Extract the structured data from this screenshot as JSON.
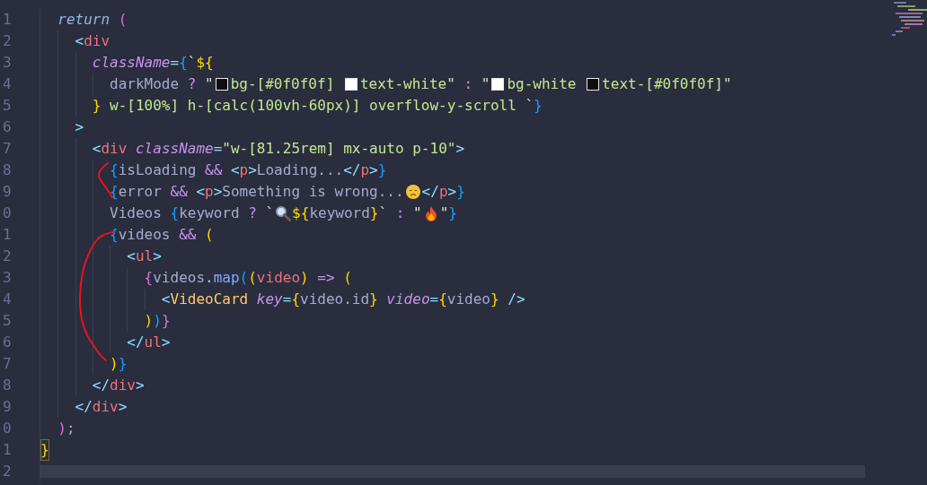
{
  "editor": {
    "lines": [
      {
        "number": "1",
        "tokens": [
          {
            "text": "  return ",
            "kind": "keyword"
          },
          {
            "text": "(",
            "kind": "b2"
          }
        ]
      },
      {
        "number": "2",
        "tokens": [
          {
            "text": "    <",
            "kind": "punct"
          },
          {
            "text": "div",
            "kind": "tag"
          }
        ]
      },
      {
        "number": "3",
        "tokens": [
          {
            "text": "      className",
            "kind": "attr"
          },
          {
            "text": "=",
            "kind": "punct"
          },
          {
            "text": "{",
            "kind": "b3"
          },
          {
            "text": "`",
            "kind": "quote"
          },
          {
            "text": "${",
            "kind": "b1"
          }
        ]
      },
      {
        "number": "4",
        "tokens": [
          {
            "text": "        darkMode ",
            "kind": "plain"
          },
          {
            "text": "?",
            "kind": "op"
          },
          {
            "text": " \"",
            "kind": "quote"
          },
          {
            "kind": "swatch",
            "color": "#0f0f0f"
          },
          {
            "text": "bg-[#0f0f0f] ",
            "kind": "string"
          },
          {
            "kind": "swatch",
            "color": "#ffffff"
          },
          {
            "text": "text-white",
            "kind": "string"
          },
          {
            "text": "\" ",
            "kind": "quote"
          },
          {
            "text": ":",
            "kind": "op"
          },
          {
            "text": " \"",
            "kind": "quote"
          },
          {
            "kind": "swatch",
            "color": "#ffffff"
          },
          {
            "text": "bg-white ",
            "kind": "string"
          },
          {
            "kind": "swatch",
            "color": "#0f0f0f"
          },
          {
            "text": "text-[#0f0f0f]",
            "kind": "string"
          },
          {
            "text": "\"",
            "kind": "quote"
          }
        ]
      },
      {
        "number": "5",
        "tokens": [
          {
            "text": "      }",
            "kind": "b1"
          },
          {
            "text": " w-[100%] h-[calc(100vh-60px)] overflow-y-scroll ",
            "kind": "string"
          },
          {
            "text": "`",
            "kind": "quote"
          },
          {
            "text": "}",
            "kind": "b3"
          }
        ]
      },
      {
        "number": "6",
        "tokens": [
          {
            "text": "    >",
            "kind": "punct"
          }
        ]
      },
      {
        "number": "7",
        "tokens": [
          {
            "text": "      <",
            "kind": "punct"
          },
          {
            "text": "div",
            "kind": "tag"
          },
          {
            "text": " className",
            "kind": "attr"
          },
          {
            "text": "=",
            "kind": "punct"
          },
          {
            "text": "\"w-[81.25rem] mx-auto p-10\"",
            "kind": "string"
          },
          {
            "text": ">",
            "kind": "punct"
          }
        ]
      },
      {
        "number": "8",
        "tokens": [
          {
            "text": "        {",
            "kind": "b3"
          },
          {
            "text": "isLoading ",
            "kind": "plain"
          },
          {
            "text": "&&",
            "kind": "op"
          },
          {
            "text": " <",
            "kind": "punct"
          },
          {
            "text": "p",
            "kind": "tag"
          },
          {
            "text": ">",
            "kind": "punct"
          },
          {
            "text": "Loading...",
            "kind": "plain"
          },
          {
            "text": "</",
            "kind": "punct"
          },
          {
            "text": "p",
            "kind": "tag"
          },
          {
            "text": ">",
            "kind": "punct"
          },
          {
            "text": "}",
            "kind": "b3"
          }
        ]
      },
      {
        "number": "9",
        "tokens": [
          {
            "text": "        {",
            "kind": "b3"
          },
          {
            "text": "error ",
            "kind": "plain"
          },
          {
            "text": "&&",
            "kind": "op"
          },
          {
            "text": " <",
            "kind": "punct"
          },
          {
            "text": "p",
            "kind": "tag"
          },
          {
            "text": ">",
            "kind": "punct"
          },
          {
            "text": "Something is wrong...",
            "kind": "plain"
          },
          {
            "kind": "sad-emoji"
          },
          {
            "text": "</",
            "kind": "punct"
          },
          {
            "text": "p",
            "kind": "tag"
          },
          {
            "text": ">",
            "kind": "punct"
          },
          {
            "text": "}",
            "kind": "b3"
          }
        ]
      },
      {
        "number": "0",
        "tokens": [
          {
            "text": "        Videos ",
            "kind": "plain"
          },
          {
            "text": "{",
            "kind": "b3"
          },
          {
            "text": "keyword ",
            "kind": "plain"
          },
          {
            "text": "?",
            "kind": "op"
          },
          {
            "text": " `",
            "kind": "quote"
          },
          {
            "kind": "search-emoji"
          },
          {
            "text": "${",
            "kind": "b1"
          },
          {
            "text": "keyword",
            "kind": "plain"
          },
          {
            "text": "}",
            "kind": "b1"
          },
          {
            "text": "` ",
            "kind": "quote"
          },
          {
            "text": ":",
            "kind": "op"
          },
          {
            "text": " \"",
            "kind": "quote"
          },
          {
            "kind": "fire-emoji"
          },
          {
            "text": "\"",
            "kind": "quote"
          },
          {
            "text": "}",
            "kind": "b3"
          }
        ]
      },
      {
        "number": "1",
        "tokens": [
          {
            "text": "        {",
            "kind": "b3"
          },
          {
            "text": "videos ",
            "kind": "plain"
          },
          {
            "text": "&&",
            "kind": "op"
          },
          {
            "text": " (",
            "kind": "b1"
          }
        ]
      },
      {
        "number": "2",
        "tokens": [
          {
            "text": "          <",
            "kind": "punct"
          },
          {
            "text": "ul",
            "kind": "tag"
          },
          {
            "text": ">",
            "kind": "punct"
          }
        ]
      },
      {
        "number": "3",
        "tokens": [
          {
            "text": "            {",
            "kind": "b2"
          },
          {
            "text": "videos",
            "kind": "plain"
          },
          {
            "text": ".",
            "kind": "punct"
          },
          {
            "text": "map",
            "kind": "func"
          },
          {
            "text": "(",
            "kind": "b3"
          },
          {
            "text": "(",
            "kind": "b1"
          },
          {
            "text": "video",
            "kind": "param"
          },
          {
            "text": ")",
            "kind": "b1"
          },
          {
            "text": " =>",
            "kind": "op"
          },
          {
            "text": " (",
            "kind": "b1"
          }
        ]
      },
      {
        "number": "4",
        "tokens": [
          {
            "text": "              <",
            "kind": "punct"
          },
          {
            "text": "VideoCard",
            "kind": "component"
          },
          {
            "text": " key",
            "kind": "attr"
          },
          {
            "text": "=",
            "kind": "punct"
          },
          {
            "text": "{",
            "kind": "b1"
          },
          {
            "text": "video.id",
            "kind": "plain"
          },
          {
            "text": "}",
            "kind": "b1"
          },
          {
            "text": " video",
            "kind": "attr"
          },
          {
            "text": "=",
            "kind": "punct"
          },
          {
            "text": "{",
            "kind": "b1"
          },
          {
            "text": "video",
            "kind": "plain"
          },
          {
            "text": "}",
            "kind": "b1"
          },
          {
            "text": " />",
            "kind": "punct"
          }
        ]
      },
      {
        "number": "5",
        "tokens": [
          {
            "text": "            )",
            "kind": "b1"
          },
          {
            "text": ")",
            "kind": "b3"
          },
          {
            "text": "}",
            "kind": "b2"
          }
        ]
      },
      {
        "number": "6",
        "tokens": [
          {
            "text": "          </",
            "kind": "punct"
          },
          {
            "text": "ul",
            "kind": "tag"
          },
          {
            "text": ">",
            "kind": "punct"
          }
        ]
      },
      {
        "number": "7",
        "tokens": [
          {
            "text": "        )",
            "kind": "b1"
          },
          {
            "text": "}",
            "kind": "b3"
          }
        ]
      },
      {
        "number": "8",
        "tokens": [
          {
            "text": "      </",
            "kind": "punct"
          },
          {
            "text": "div",
            "kind": "tag"
          },
          {
            "text": ">",
            "kind": "punct"
          }
        ]
      },
      {
        "number": "9",
        "tokens": [
          {
            "text": "    </",
            "kind": "punct"
          },
          {
            "text": "div",
            "kind": "tag"
          },
          {
            "text": ">",
            "kind": "punct"
          }
        ]
      },
      {
        "number": "0",
        "tokens": [
          {
            "text": "  )",
            "kind": "b2"
          },
          {
            "text": ";",
            "kind": "plain"
          }
        ]
      },
      {
        "number": "1",
        "tokens": [
          {
            "text": "}",
            "kind": "b1",
            "matched": true
          }
        ]
      },
      {
        "number": "2"
      }
    ]
  }
}
